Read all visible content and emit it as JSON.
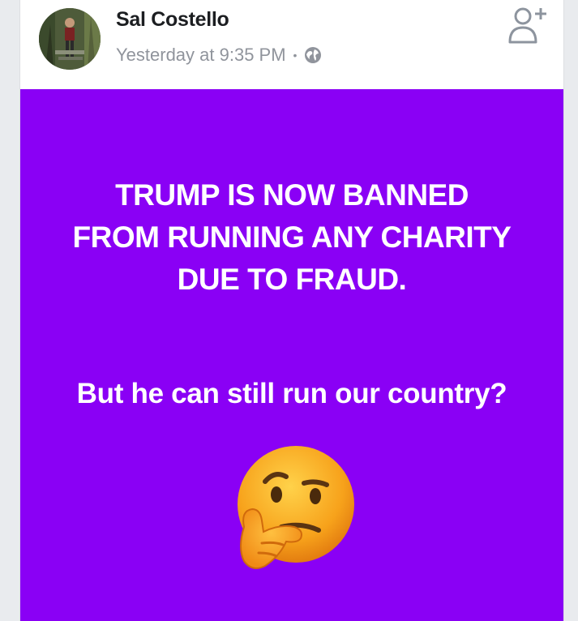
{
  "post": {
    "author_name": "Sal Costello",
    "timestamp": "Yesterday at 9:35 PM",
    "separator": "•",
    "privacy_icon": "globe-icon",
    "follow_icon": "add-friend-icon",
    "background_color": "#8a00f5",
    "headline_lines": [
      "TRUMP IS NOW BANNED",
      "FROM RUNNING ANY CHARITY",
      "DUE TO FRAUD."
    ],
    "question": "But he can still run our country?",
    "emoji": "thinking-face-emoji"
  }
}
